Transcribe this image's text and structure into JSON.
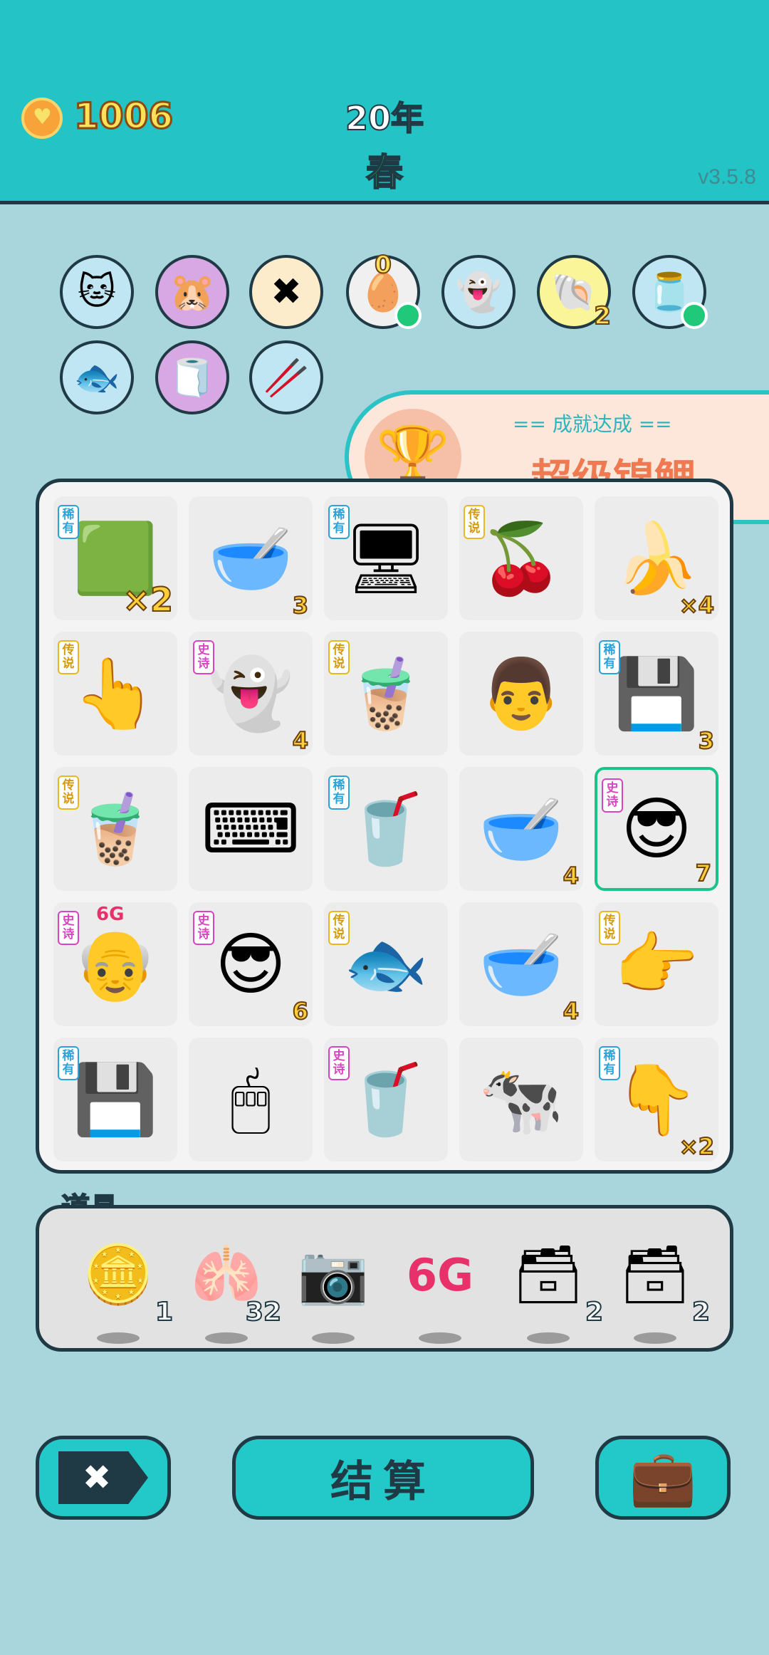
{
  "header": {
    "coins": "1006",
    "year": "20年",
    "season": "春",
    "version": "v3.5.8"
  },
  "badges": [
    {
      "icon": "🐱",
      "bg": "#bfe6f2",
      "count": "",
      "dot": false
    },
    {
      "icon": "🐹",
      "bg": "#d7a8e3",
      "count": "",
      "dot": false
    },
    {
      "icon": "✖",
      "bg": "#fdeccc",
      "count": "",
      "dot": false
    },
    {
      "icon": "🥚",
      "bg": "#f0f0f0",
      "count": "0",
      "dot": true
    },
    {
      "icon": "👻",
      "bg": "#bfe6f2",
      "count": "",
      "dot": false
    },
    {
      "icon": "🐚",
      "bg": "#fbf59a",
      "count": "2",
      "dot": false
    },
    {
      "icon": "🫙",
      "bg": "#bfe6f2",
      "count": "",
      "dot": true
    },
    {
      "icon": "🐟",
      "bg": "#bfe6f2",
      "count": "",
      "dot": false
    },
    {
      "icon": "🧻",
      "bg": "#d7a8e3",
      "count": "",
      "dot": false
    },
    {
      "icon": "🥢",
      "bg": "#bfe6f2",
      "count": "",
      "dot": false
    }
  ],
  "achievement": {
    "subtitle": "== 成就达成 ==",
    "title": "超级锦鲤"
  },
  "grid": [
    [
      {
        "icon": "🟩",
        "tag": "稀有",
        "tc": "r",
        "count": "×2",
        "big": true
      },
      {
        "icon": "🥣",
        "count": "3"
      },
      {
        "icon": "🖥",
        "tag": "稀有",
        "tc": "r",
        "count": ""
      },
      {
        "icon": "🍒",
        "tag": "传说",
        "tc": "l",
        "count": ""
      },
      {
        "icon": "🍌",
        "count": "×4"
      }
    ],
    [
      {
        "icon": "👆",
        "tag": "传说",
        "tc": "l",
        "count": ""
      },
      {
        "icon": "👻",
        "tag": "史诗",
        "tc": "e",
        "count": "4"
      },
      {
        "icon": "🧋",
        "tag": "传说",
        "tc": "l",
        "count": ""
      },
      {
        "icon": "👨",
        "count": ""
      },
      {
        "icon": "💾",
        "tag": "稀有",
        "tc": "r",
        "count": "3"
      }
    ],
    [
      {
        "icon": "🧋",
        "tag": "传说",
        "tc": "l",
        "count": ""
      },
      {
        "icon": "⌨",
        "count": ""
      },
      {
        "icon": "🥤",
        "tag": "稀有",
        "tc": "r",
        "count": ""
      },
      {
        "icon": "🥣",
        "count": "4"
      },
      {
        "icon": "😎",
        "tag": "史诗",
        "tc": "e",
        "count": "7",
        "sel": true
      }
    ],
    [
      {
        "icon": "👴",
        "tag": "史诗",
        "tc": "e",
        "count": "",
        "extra": "6G"
      },
      {
        "icon": "😎",
        "tag": "史诗",
        "tc": "e",
        "count": "6"
      },
      {
        "icon": "🐟",
        "tag": "传说",
        "tc": "l",
        "count": ""
      },
      {
        "icon": "🥣",
        "count": "4"
      },
      {
        "icon": "👉",
        "tag": "传说",
        "tc": "l",
        "count": ""
      }
    ],
    [
      {
        "icon": "💾",
        "tag": "稀有",
        "tc": "r",
        "count": ""
      },
      {
        "icon": "🖱",
        "count": ""
      },
      {
        "icon": "🥤",
        "tag": "史诗",
        "tc": "e",
        "count": ""
      },
      {
        "icon": "🐄",
        "count": ""
      },
      {
        "icon": "👇",
        "tag": "稀有",
        "tc": "r",
        "count": "×2"
      }
    ]
  ],
  "tools": {
    "label": "道具",
    "items": [
      {
        "icon": "🪙",
        "count": "1"
      },
      {
        "icon": "🫁",
        "count": "32"
      },
      {
        "icon": "📷",
        "count": ""
      },
      {
        "icon": "6G",
        "count": ""
      },
      {
        "icon": "🗃",
        "count": "2"
      },
      {
        "icon": "🗃",
        "count": "2"
      }
    ]
  },
  "buttons": {
    "close": "✖",
    "settle": "结算",
    "bag": "💼"
  }
}
